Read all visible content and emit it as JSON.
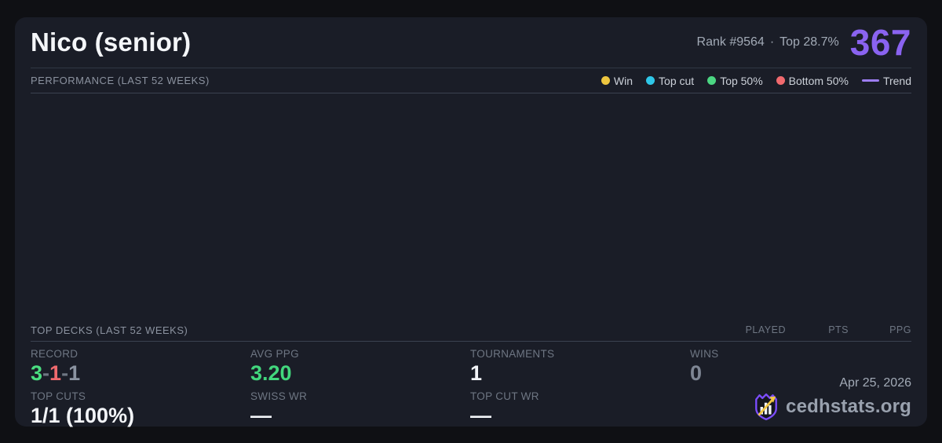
{
  "player": {
    "name": "Nico (senior)",
    "rank": "Rank #9564",
    "separator": "·",
    "top_percent": "Top 28.7%",
    "points": "367"
  },
  "performance": {
    "title": "PERFORMANCE (LAST 52 WEEKS)",
    "legend": [
      {
        "label": "Win",
        "color": "#eec63f",
        "marker": "dot"
      },
      {
        "label": "Top cut",
        "color": "#2fc7e8",
        "marker": "dot"
      },
      {
        "label": "Top 50%",
        "color": "#4bd682",
        "marker": "dot"
      },
      {
        "label": "Bottom 50%",
        "color": "#f16a6e",
        "marker": "dot"
      },
      {
        "label": "Trend",
        "color": "#9d7df2",
        "marker": "line"
      }
    ]
  },
  "chart_data": {
    "type": "scatter",
    "points": [],
    "title": "PERFORMANCE (LAST 52 WEEKS)",
    "legend_entries": [
      "Win",
      "Top cut",
      "Top 50%",
      "Bottom 50%",
      "Trend"
    ]
  },
  "top_decks": {
    "title": "TOP DECKS (LAST 52 WEEKS)",
    "columns": [
      "PLAYED",
      "PTS",
      "PPG"
    ],
    "rows": []
  },
  "stats": {
    "record": {
      "label": "RECORD",
      "wins": "3",
      "sep1": "-",
      "losses": "1",
      "sep2": "-",
      "draws": "1",
      "wins_color": "#4ade80",
      "losses_color": "#ef6a6e",
      "draws_color": "#8b93a1"
    },
    "avg_ppg": {
      "label": "AVG PPG",
      "value": "3.20",
      "color": "#42d77d"
    },
    "tournaments": {
      "label": "TOURNAMENTS",
      "value": "1"
    },
    "wins": {
      "label": "WINS",
      "value": "0"
    },
    "top_cuts": {
      "label": "TOP CUTS",
      "value": "1/1 (100%)"
    },
    "swiss_wr": {
      "label": "SWISS WR",
      "value": "—"
    },
    "top_cut_wr": {
      "label": "TOP CUT WR",
      "value": "—"
    }
  },
  "footer": {
    "date": "Apr 25, 2026",
    "brand": "cedhstats.org"
  },
  "colors": {
    "page_bg": "#0f1014",
    "card_bg": "#1a1d27",
    "accent_purple": "#8a63f0",
    "divider": "#3b4250"
  }
}
